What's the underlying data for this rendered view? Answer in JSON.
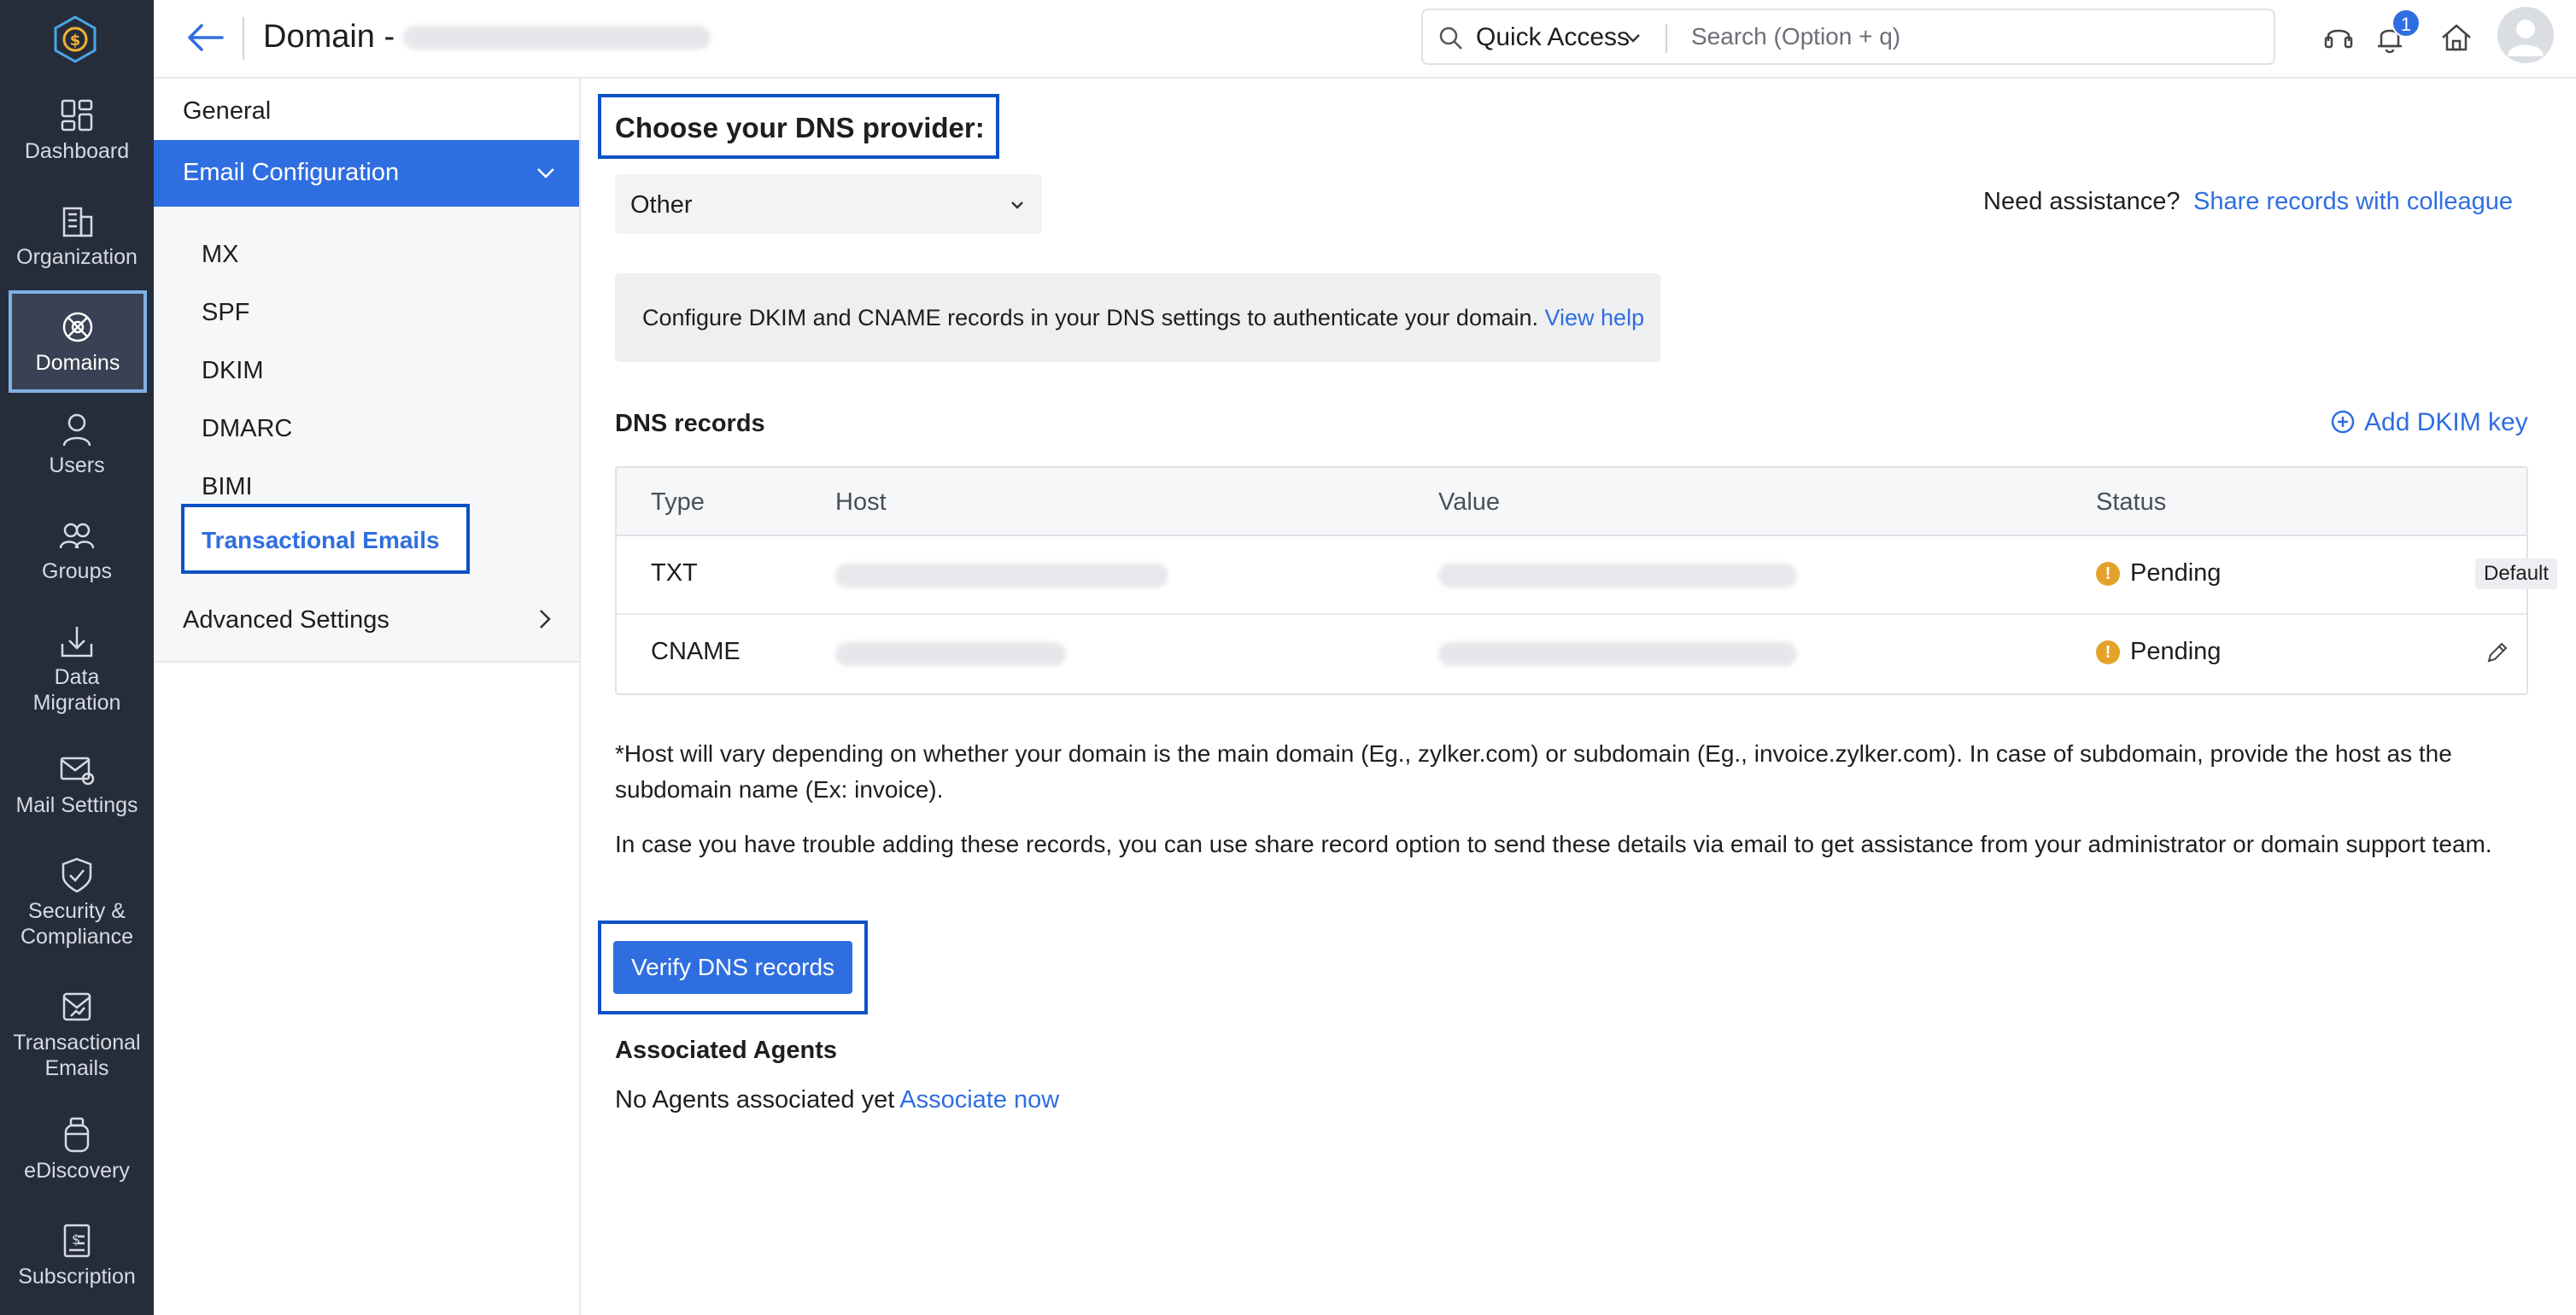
{
  "nav": {
    "items": [
      {
        "label": "Dashboard",
        "icon": "dashboard-icon"
      },
      {
        "label": "Organization",
        "icon": "organization-icon"
      },
      {
        "label": "Domains",
        "icon": "domains-icon"
      },
      {
        "label": "Users",
        "icon": "user-icon"
      },
      {
        "label": "Groups",
        "icon": "groups-icon"
      },
      {
        "label": "Data Migration",
        "icon": "data-migration-icon"
      },
      {
        "label": "Mail Settings",
        "icon": "mail-settings-icon"
      },
      {
        "label": "Security & Compliance",
        "icon": "security-icon"
      },
      {
        "label": "Transactional Emails",
        "icon": "transactional-emails-icon"
      },
      {
        "label": "eDiscovery",
        "icon": "ediscovery-icon"
      },
      {
        "label": "Subscription",
        "icon": "subscription-icon"
      }
    ],
    "active": "Domains"
  },
  "header": {
    "title": "Domain -",
    "quick_access": "Quick Access",
    "search_placeholder": "Search (Option + q)",
    "notification_count": "1"
  },
  "subnav": {
    "general": "General",
    "email_config": "Email Configuration",
    "children": [
      "MX",
      "SPF",
      "DKIM",
      "DMARC",
      "BIMI",
      "Transactional Emails"
    ],
    "selected": "Transactional Emails",
    "advanced": "Advanced Settings"
  },
  "main": {
    "provider_heading": "Choose your DNS provider:",
    "provider_value": "Other",
    "assist_question": "Need assistance?",
    "assist_link": "Share records with colleague",
    "info_text": "Configure DKIM and CNAME records in your DNS settings to authenticate your domain.",
    "info_link": "View help",
    "dns_title": "DNS records",
    "add_dkim": "Add DKIM key",
    "table": {
      "headers": [
        "Type",
        "Host",
        "Value",
        "Status"
      ],
      "rows": [
        {
          "type": "TXT",
          "status": "Pending",
          "tag": "Default"
        },
        {
          "type": "CNAME",
          "status": "Pending"
        }
      ]
    },
    "note1": "*Host will vary depending on whether your domain is the main domain (Eg., zylker.com) or subdomain (Eg., invoice.zylker.com). In case of subdomain, provide the host as the subdomain name (Ex: invoice).",
    "note2": "In case you have trouble adding these records, you can use share record option to send these details via email to get assistance from your administrator or domain support team.",
    "verify_button": "Verify DNS records",
    "agents_title": "Associated Agents",
    "agents_text": "No Agents associated yet",
    "agents_link": "Associate now"
  },
  "colors": {
    "accent": "#2f6ee0",
    "rail_bg": "#262d3a",
    "highlight_border": "#0b52c6",
    "pending": "#e5a22a"
  }
}
